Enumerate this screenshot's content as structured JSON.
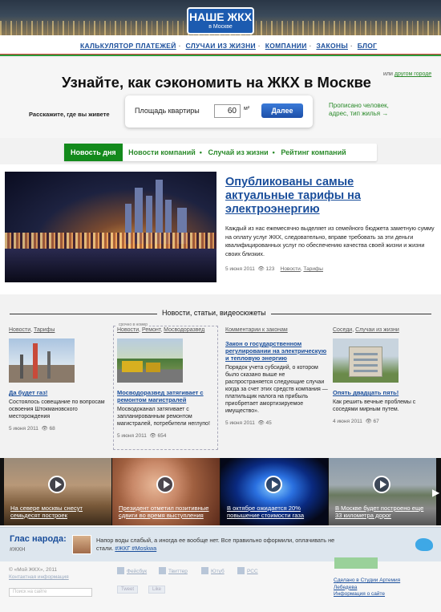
{
  "header": {
    "logo_title": "НАШЕ ЖКХ",
    "logo_sub": "в Москве"
  },
  "nav": {
    "items": [
      "КАЛЬКУЛЯТОР ПЛАТЕЖЕЙ",
      "СЛУЧАИ ИЗ ЖИЗНИ",
      "КОМПАНИИ",
      "ЗАКОНЫ",
      "БЛОГ"
    ]
  },
  "calc": {
    "title": "Узнайте, как сэкономить на ЖКХ в Москве",
    "other_prefix": "или",
    "other_link": "другом городе",
    "where": "Расскажите, где вы живете",
    "area_label": "Площадь квартиры",
    "area_value": "60",
    "unit": "м²",
    "submit": "Далее",
    "registered": "Прописано человек, адрес, тип жилья →"
  },
  "tabs": [
    "Новость дня",
    "Новости компаний",
    "Случай из жизни",
    "Рейтинг компаний"
  ],
  "main_article": {
    "title": "Опубликованы самые актуальные тарифы на электроэнергию",
    "text": "Каждый из нас ежемесячно выделяет из семейного бюджета заметную сумму на оплату услуг ЖКХ, следовательно, вправе требовать за эти деньги квалифицированных услуг по обеспечению качества своей жизни и жизни своих близких.",
    "date": "5 июня 2011",
    "views": "123",
    "tags": [
      "Новости",
      "Тарифы"
    ]
  },
  "section_title": "Новости, статьи, видеосюжеты",
  "news": [
    {
      "cats": [
        "Новости",
        "Тарифы"
      ],
      "title": "Да будет газ!",
      "desc": "Состоялось совещание по вопросам освоения Штокмановского месторождения",
      "date": "5 июня 2011",
      "views": "68"
    },
    {
      "tag": "срочно в номер",
      "cats": [
        "Новости",
        "Ремонт",
        "Мосводоразвед"
      ],
      "title": "Мосводоразвед затягивает с ремонтом магистралей",
      "desc": "Мосводоканал затягивает с запланированным ремонтом магистралей, потребители неглупо!",
      "date": "5 июня 2011",
      "views": "654"
    },
    {
      "cats": [
        "Комментарии к законам"
      ],
      "title": "Закон о государственном регулировании на электрическую и тепловую энергию",
      "desc": "Порядок учета субсидий, о котором было сказано выше не распространяется следующие случаи  когда за счет этих средств компания — платильщик налога на прибыль приобретает амортизируемое имущество».",
      "date": "5 июня 2011",
      "views": "45"
    },
    {
      "cats": [
        "Соседи",
        "Случаи из жизни"
      ],
      "title": "Опять двадцать пять!",
      "desc": "Как решить вечные проблемы с соседями мирным путем.",
      "date": "4 июня 2011",
      "views": "67"
    }
  ],
  "videos": [
    {
      "caption": "На севере москвы снесут семьдесят построек"
    },
    {
      "caption": "Президент отметил позитивные сдвиги во время выступления"
    },
    {
      "caption": "В октябре ожидается 20% повышение стоимости газа"
    },
    {
      "caption": "В Москве будет построено еще 33 километра дорог"
    }
  ],
  "voice": {
    "title": "Глас народа:",
    "tag": "#ЖКН",
    "message": "Напор воды слабый, а иногда ее вообще нет. Все правильно оформили, оплачивать не стали.",
    "hashtags": "#ЖКГ #Moskwa"
  },
  "footer": {
    "copyright": "© «Мой ЖКХ», 2011",
    "contact": "Контактная информация",
    "search_placeholder": "Поиск на сайте",
    "social": [
      "Фейсбук",
      "Твиттер",
      "Ютуб",
      "РСС"
    ],
    "like_buttons": [
      "Tweet",
      "Like"
    ],
    "made_by": "Сделано в Студии Артемия Лебедева",
    "made_info": "Информация о сайте"
  },
  "colors": {
    "brand_blue": "#1a4e9b",
    "green": "#138a1c",
    "accent_red": "#d44"
  }
}
